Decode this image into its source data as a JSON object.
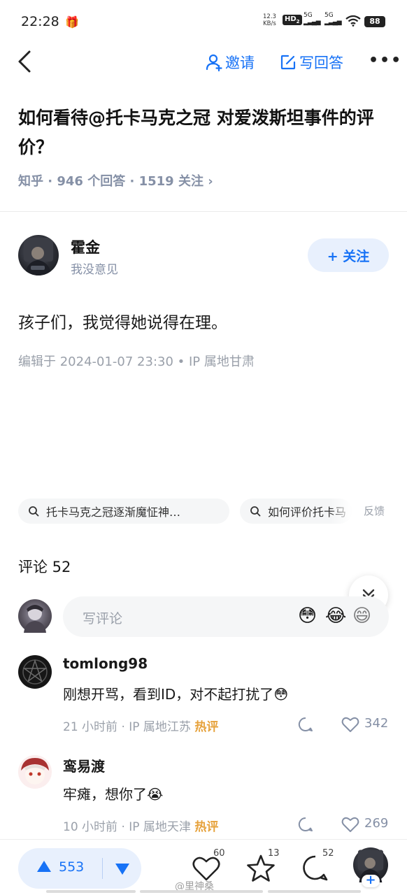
{
  "status_bar": {
    "time": "22:28",
    "net_speed_value": "12.3",
    "net_speed_unit": "KB/s",
    "hd_badge": "HD",
    "hd_sub": "2",
    "signal_1": "5G",
    "signal_2": "5G",
    "battery": "88"
  },
  "nav": {
    "invite_label": "邀请",
    "write_answer_label": "写回答"
  },
  "question": {
    "title": "如何看待@托卡马克之冠 对爱泼斯坦事件的评价？",
    "meta": "知乎 · 946 个回答 · 1519 关注 ›"
  },
  "answer": {
    "author_name": "霍金",
    "author_bio": "我没意见",
    "follow_label": "+ 关注",
    "content": "孩子们，我觉得她说得在理。",
    "edit_info": "编辑于 2024-01-07 23:30 • IP 属地甘肃"
  },
  "related_searches": {
    "items": [
      "托卡马克之冠逐渐魔怔神…",
      "如何评价托卡马"
    ],
    "feedback_label": "反馈"
  },
  "comments": {
    "header": "评论 52",
    "input_placeholder": "写评论",
    "emojis": [
      "😳",
      "😂",
      "😄"
    ],
    "items": [
      {
        "author": "tomlong98",
        "text": "刚想开骂，看到ID，对不起打扰了",
        "text_emoji": "😳",
        "time": "21 小时前",
        "location": "IP 属地江苏",
        "hot_label": "热评",
        "likes": "342"
      },
      {
        "author": "鸾易渡",
        "text": "牢瘫，想你了",
        "text_emoji": "😭",
        "time": "10 小时前",
        "location": "IP 属地天津",
        "hot_label": "热评",
        "likes": "269"
      }
    ]
  },
  "bottom_bar": {
    "vote_count": "553",
    "like_count": "60",
    "favorite_count": "13",
    "comment_count": "52",
    "watermark": "@里神桑"
  },
  "colors": {
    "accent": "#1772f6",
    "hot": "#e6a23c",
    "muted": "#8590a6"
  }
}
